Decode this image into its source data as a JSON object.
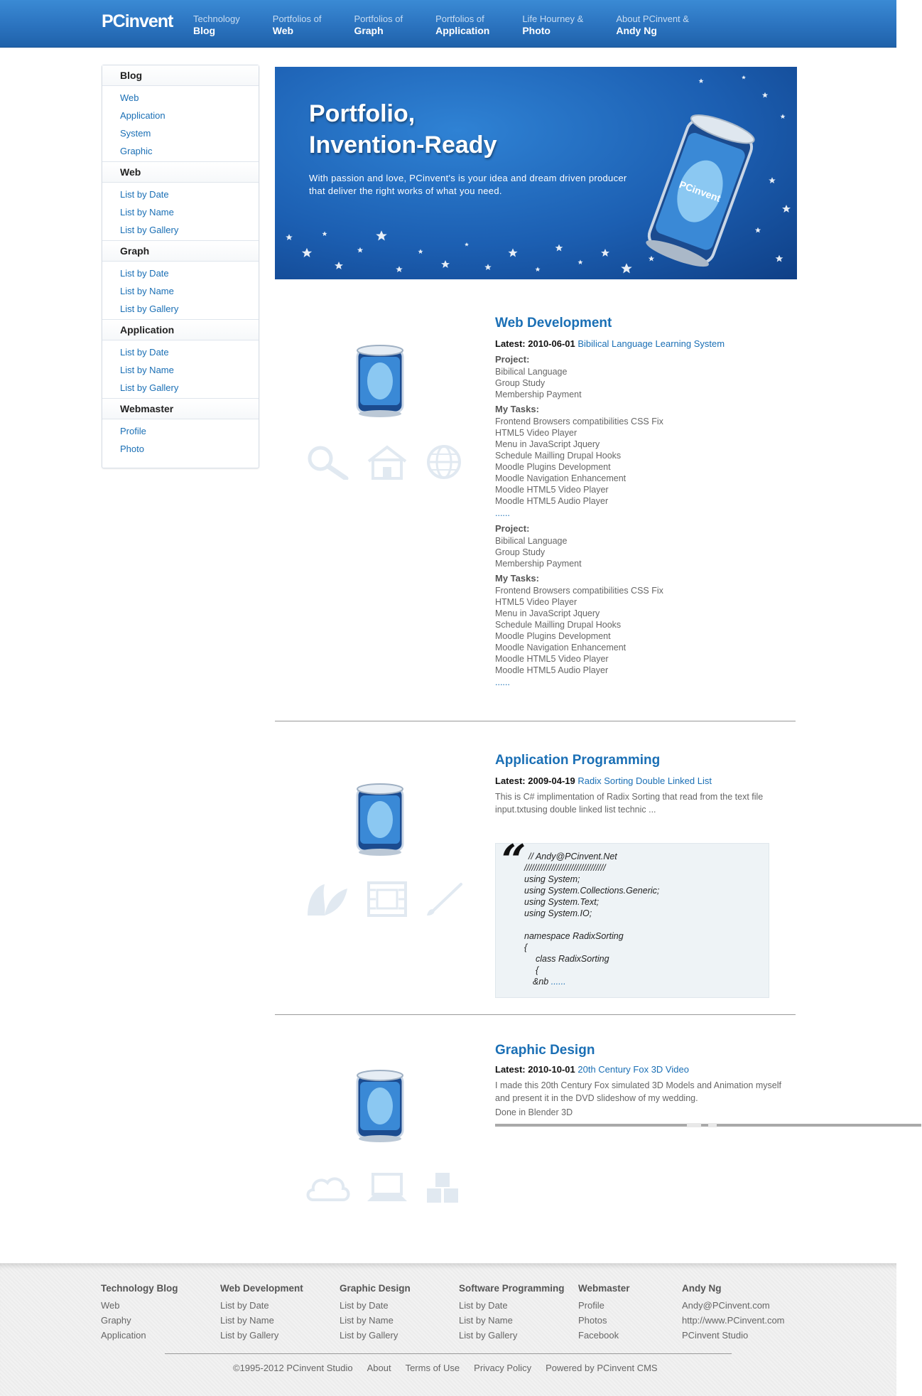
{
  "header": {
    "logo": "PCinvent",
    "nav": [
      {
        "small": "Technology",
        "big": "Blog"
      },
      {
        "small": "Portfolios of",
        "big": "Web"
      },
      {
        "small": "Portfolios of",
        "big": "Graph"
      },
      {
        "small": "Portfolios of",
        "big": "Application"
      },
      {
        "small": "Life Hourney &",
        "big": "Photo"
      },
      {
        "small": "About PCinvent &",
        "big": "Andy Ng"
      }
    ]
  },
  "sidebar": {
    "groups": [
      {
        "title": "Blog",
        "links": [
          "Web",
          "Application",
          "System",
          "Graphic"
        ]
      },
      {
        "title": "Web",
        "links": [
          "List by Date",
          "List by Name",
          "List by Gallery"
        ]
      },
      {
        "title": "Graph",
        "links": [
          "List by Date",
          "List by Name",
          "List by Gallery"
        ]
      },
      {
        "title": "Application",
        "links": [
          "List by Date",
          "List by Name",
          "List by Gallery"
        ]
      },
      {
        "title": "Webmaster",
        "links": [
          "Profile",
          "Photo"
        ]
      }
    ]
  },
  "banner": {
    "title_line1": "Portfolio,",
    "title_line2": "Invention-Ready",
    "text": "With passion and love, PCinvent's is your idea and dream driven producer that deliver the right works of what you need.",
    "can_label": "PCinvent"
  },
  "sections": {
    "web": {
      "title": "Web Development",
      "latest_label": "Latest:",
      "date": "2010-06-01",
      "link": "Bibilical Language Learning System",
      "blocks": [
        {
          "project_label": "Project:",
          "project": [
            "Bibilical Language",
            "Group Study",
            "Membership Payment"
          ],
          "tasks_label": "My Tasks:",
          "tasks": [
            "Frontend Browsers compatibilities CSS Fix",
            "HTML5 Video Player",
            "Menu in JavaScript Jquery",
            "Schedule Mailling Drupal Hooks",
            "Moodle Plugins Development",
            "Moodle Navigation Enhancement",
            "Moodle HTML5 Video Player",
            "Moodle HTML5 Audio Player"
          ],
          "more": "......"
        },
        {
          "project_label": "Project:",
          "project": [
            "Bibilical Language",
            "Group Study",
            "Membership Payment"
          ],
          "tasks_label": "My Tasks:",
          "tasks": [
            "Frontend Browsers compatibilities CSS Fix",
            "HTML5 Video Player",
            "Menu in JavaScript Jquery",
            "Schedule Mailling Drupal Hooks",
            "Moodle Plugins Development",
            "Moodle Navigation Enhancement",
            "Moodle HTML5 Video Player",
            "Moodle HTML5 Audio Player"
          ],
          "more": "......"
        }
      ]
    },
    "app": {
      "title": "Application Programming",
      "latest_label": "Latest:",
      "date": "2009-04-19",
      "link": "Radix Sorting Double Linked List",
      "desc": "This is C# implimentation of Radix Sorting that read from the text file input.txtusing double linked list technic ...",
      "quote_mark": "“",
      "code": [
        "// Andy@PCinvent.Net",
        "/////////////////////////////////",
        "using System;",
        "using System.Collections.Generic;",
        "using System.Text;",
        "using System.IO;",
        "",
        "namespace RadixSorting",
        "{",
        "   class RadixSorting",
        "   {",
        "   &nb"
      ],
      "code_more": "......"
    },
    "graphic": {
      "title": "Graphic Design",
      "latest_label": "Latest:",
      "date": "2010-10-01",
      "link": "20th Century Fox 3D Video",
      "desc": "I made this 20th Century Fox simulated 3D Models and Animation myself and present it in the DVD slideshow of my wedding.",
      "note": "Done in Blender 3D"
    }
  },
  "footer": {
    "cols": [
      {
        "title": "Technology Blog",
        "links": [
          "Web",
          "Graphy",
          "Application"
        ]
      },
      {
        "title": "Web Development",
        "links": [
          "List by Date",
          "List by Name",
          "List by Gallery"
        ]
      },
      {
        "title": "Graphic Design",
        "links": [
          "List by Date",
          "List by Name",
          "List by Gallery"
        ]
      },
      {
        "title": "Software Programming",
        "links": [
          "List by Date",
          "List by Name",
          "List by Gallery"
        ]
      },
      {
        "title": "Webmaster",
        "links": [
          "Profile",
          "Photos",
          "Facebook"
        ]
      },
      {
        "title": "Andy Ng",
        "links": [
          "Andy@PCinvent.com",
          "http://www.PCinvent.com",
          "PCinvent Studio"
        ]
      }
    ],
    "bottom": [
      "©1995-2012 PCinvent Studio",
      "About",
      "Terms of Use",
      "Privacy Policy",
      "Powered by PCinvent CMS"
    ]
  },
  "colors": {
    "accent": "#1a6fb5",
    "header": "#2b73bf"
  }
}
